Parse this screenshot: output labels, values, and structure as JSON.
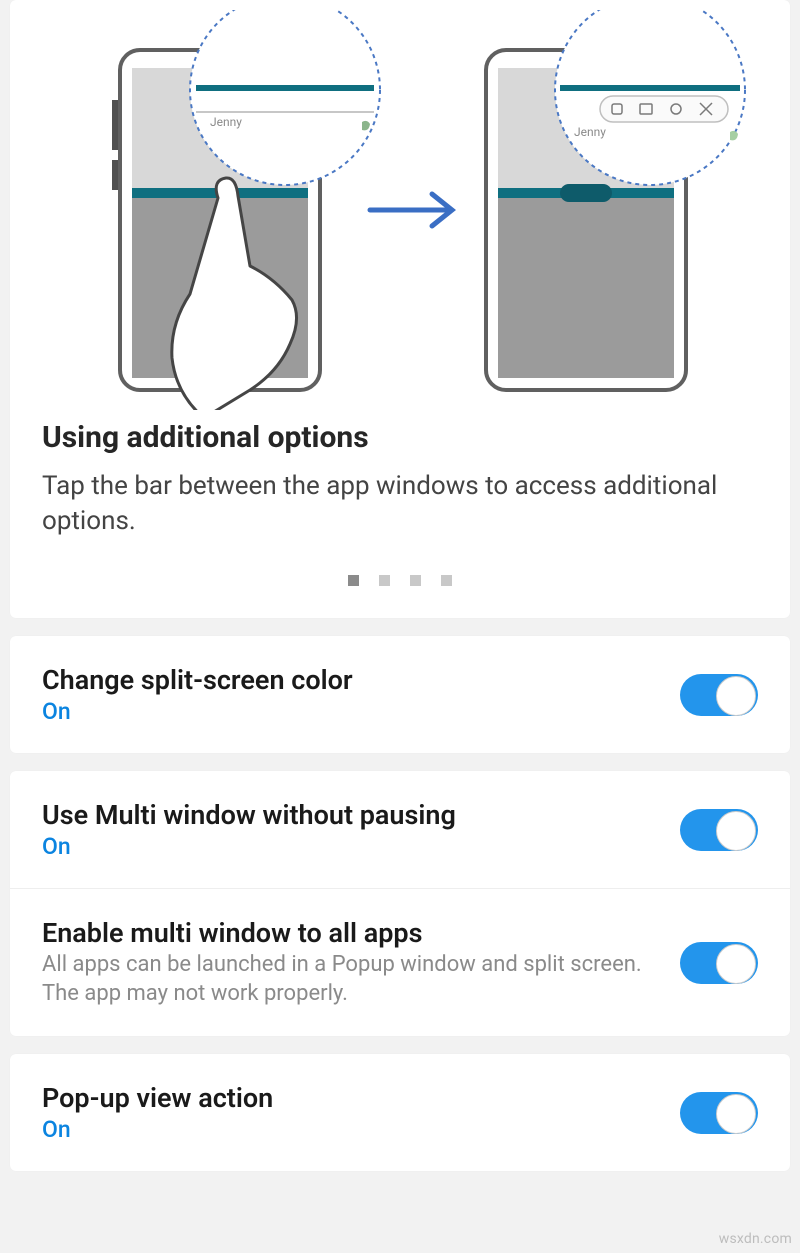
{
  "help": {
    "title": "Using additional options",
    "description": "Tap the bar between the app windows to access additional options.",
    "page_count": 4,
    "active_page_index": 0,
    "bubble_label": "Jenny"
  },
  "settings": [
    {
      "title": "Change split-screen color",
      "sub": "On",
      "desc": "",
      "on": true
    },
    {
      "title": "Use Multi window without pausing",
      "sub": "On",
      "desc": "",
      "on": true
    },
    {
      "title": "Enable multi window to all apps",
      "sub": "",
      "desc": "All apps can be launched in a Popup window and split screen. The app may not work properly.",
      "on": true
    },
    {
      "title": "Pop-up view action",
      "sub": "On",
      "desc": "",
      "on": true
    }
  ],
  "watermark": "wsxdn.com"
}
